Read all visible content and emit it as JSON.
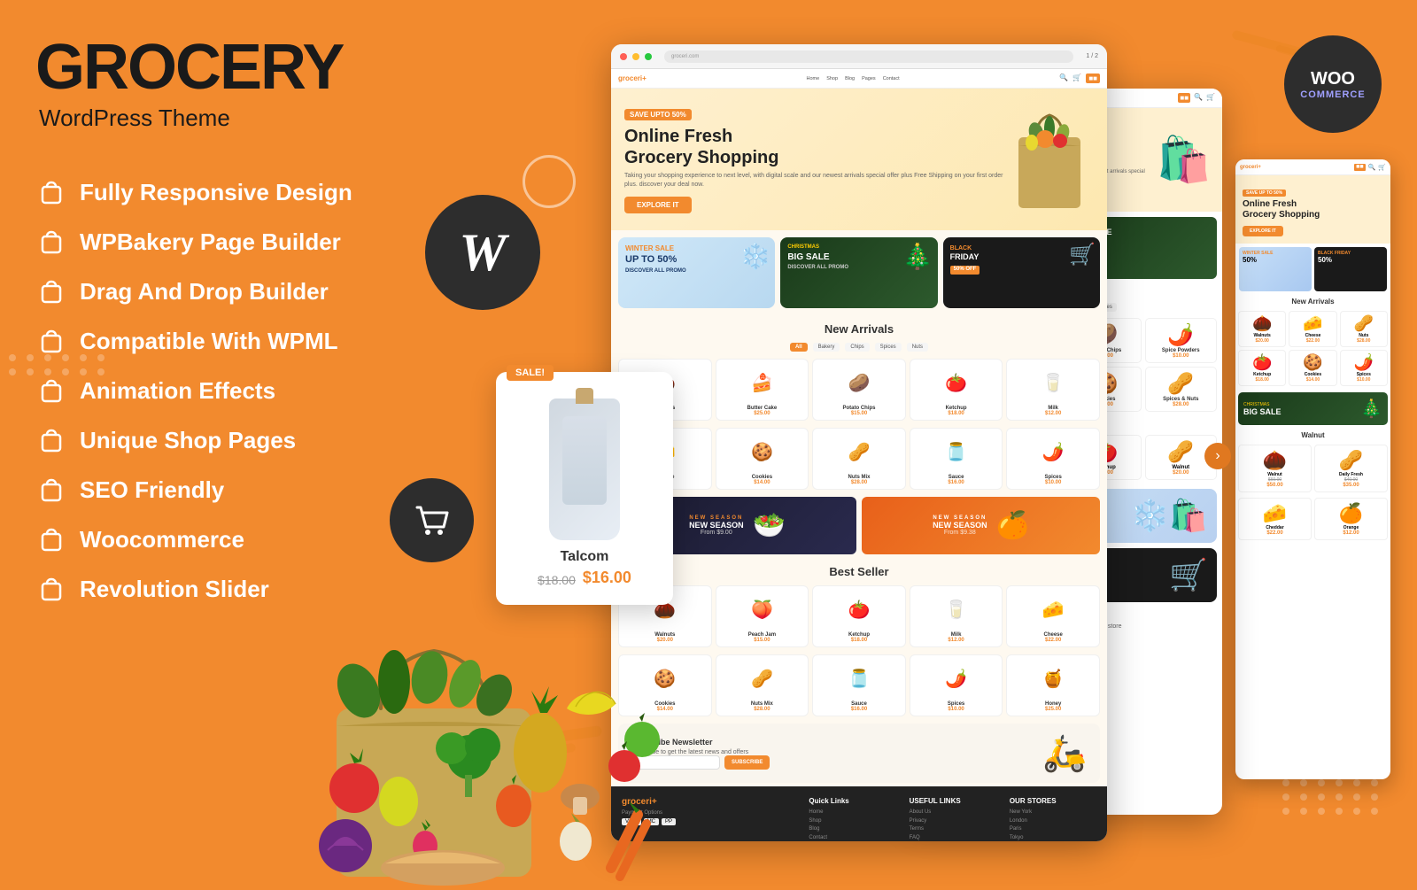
{
  "brand": {
    "title": "GROCERY",
    "subtitle": "WordPress Theme"
  },
  "features": [
    "Fully Responsive Design",
    "WPBakery Page Builder",
    "Drag And Drop Builder",
    "Compatible With WPML",
    "Animation Effects",
    "Unique Shop Pages",
    "SEO Friendly",
    "Woocommerce",
    "Revolution Slider"
  ],
  "hero": {
    "badge": "SAVE UPTO 50%",
    "title": "Online Fresh\nGrocery Shopping",
    "description": "Taking your shopping experience to next level, with digital scale and our newest arrivals special offer plus Free Shipping on your first order plus. discover your deal now.",
    "button": "EXPLORE IT"
  },
  "product_popup": {
    "sale_badge": "SALE!",
    "name": "Talcom",
    "price_old": "$18.00",
    "price_new": "$16.00"
  },
  "woo": {
    "text": "WOO",
    "sub": "COMMERCE"
  },
  "sections": {
    "new_arrivals": "New Arrivals",
    "best_seller": "Best Seller",
    "subscribe_title": "Subscribe Newsletter"
  },
  "colors": {
    "primary": "#F28A2E",
    "dark": "#2d2d2d",
    "bg": "#F28A2E",
    "white": "#ffffff"
  },
  "products": [
    {
      "name": "Walnuts",
      "price": "$20.00",
      "emoji": "🌰"
    },
    {
      "name": "Butter Cake",
      "price": "$25.00",
      "emoji": "🍰"
    },
    {
      "name": "Potato Chips",
      "price": "$15.00",
      "emoji": "🥔"
    },
    {
      "name": "Ketchup",
      "price": "$18.00",
      "emoji": "🍅"
    },
    {
      "name": "Milk",
      "price": "$12.00",
      "emoji": "🥛"
    },
    {
      "name": "Cheese",
      "price": "$22.00",
      "emoji": "🧀"
    },
    {
      "name": "Cookies",
      "price": "$14.00",
      "emoji": "🍪"
    },
    {
      "name": "Nuts Mix",
      "price": "$28.00",
      "emoji": "🥜"
    },
    {
      "name": "Sauce",
      "price": "$16.00",
      "emoji": "🫙"
    },
    {
      "name": "Spices",
      "price": "$10.00",
      "emoji": "🌶️"
    }
  ],
  "promo_cards": [
    {
      "label": "WINTER SALE\nUP TO 50%",
      "bg": "#d0e8f8"
    },
    {
      "label": "CHRISTMAS\nBIG SALE",
      "bg": "#2d4a2d"
    },
    {
      "label": "BLACK FRIDAY",
      "bg": "#1a1a1a"
    }
  ],
  "footer_links": {
    "quick_links": "Quick Links",
    "useful_links": "USEFUL LINKS",
    "our_stores": "OUR STORES"
  }
}
